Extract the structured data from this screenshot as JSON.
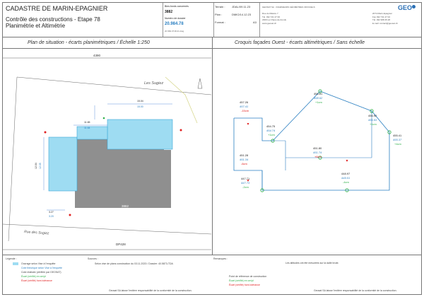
{
  "header": {
    "org": "CADASTRE DE MARIN-EPAGNIER",
    "subtitle_line1": "Contrôle des constructions - Etape 78",
    "subtitle_line2": "Planimétrie et Altimétrie",
    "bienfonds_label": "Bien-fonds concernés",
    "bienfonds_value": "3882",
    "dossier_label": "Numéro de dossier",
    "dossier_value": "20.984.78",
    "small_ref": "20 984.3718.21.dwg",
    "terrain_label": "Terrain :",
    "terrain_value": "JDAL/09.11.23",
    "plan_label": "Plan :",
    "plan_value": "DMIO/14.12.23",
    "format_label": "Format :",
    "format_value": "A3",
    "company_logo": "GEO",
    "company_name": "GEOSAT SA · INGÉNIEURS GÉOMÈTRES OFFICIELS",
    "addr_left": [
      "Rue du Mélèze 7",
      "Tél. 032 721 27 00",
      "2300 La Chaux-de-Fonds",
      "www.geosat.ch"
    ],
    "addr_right": [
      "2074 Marin-Epagnier",
      "Fax 032 731 27 02",
      "Tél. 032 968 45 28",
      "E-mail: contact@geosat.ch"
    ]
  },
  "left_panel": {
    "title": "Plan de situation - écarts planimétriques / Échelle 1:250",
    "labels": {
      "parcel_top": "4390",
      "parcel_main": "3882",
      "parcel_dp": "DP428",
      "parcel_bottom": "4036",
      "street_top": "Les Sugiez",
      "street_bottom": "Rue des Sugiez"
    },
    "dims_black": [
      "15.04",
      "11.65",
      "12.04",
      "3.27"
    ],
    "dims_blue": [
      "15.00",
      "11.64",
      "12.05",
      "3.20"
    ]
  },
  "right_panel": {
    "title": "Croquis façades Ouest - écarts altimétriques / Sans échelle",
    "points": [
      {
        "black": "458.61",
        "blue": "458.62",
        "green": "+1cm"
      },
      {
        "black": "457.26",
        "blue": "457.41",
        "red": "-15cm"
      },
      {
        "black": "456.92",
        "blue": "456.93",
        "green": "+1cm"
      },
      {
        "black": "455.41",
        "blue": "455.37",
        "green": "+4cm"
      },
      {
        "black": "454.75",
        "blue": "454.74",
        "green": "+1cm"
      },
      {
        "black": "451.80",
        "blue": "451.74",
        "red": "+6cm"
      },
      {
        "black": "451.28",
        "blue": "451.34",
        "red": "-6cm"
      },
      {
        "black": "448.97",
        "blue": "449.01",
        "green": "-4cm"
      },
      {
        "black": "447.71",
        "blue": "447.73",
        "green": "-2cm"
      }
    ]
  },
  "legend": {
    "label": "Légende :",
    "items": [
      "Ouvrage selon Vise à l'enquête",
      "Cote théorique selon Vise à l'enquête",
      "Cote réalisée (vérifiée par GEOSAT)",
      "Écart (vérifié) en cm/pl",
      "Écart (vérifié) hors tolérance"
    ],
    "sources_label": "Sources :",
    "sources_text": "Selon vise de plans construction du 03.11.2023 / Dossier: 40.5873-TDA",
    "remarks_label": "Remarques :",
    "remarks_text": "Les altitudes ont été mesurées sur la dalle brute.",
    "right_items": [
      "Point de référence de construction",
      "Écart (vérifié) en cm/pl",
      "Écart (vérifié) hors tolérance"
    ],
    "footer": "Geosat SA laisse l'entière responsabilité de la conformité de la construction."
  }
}
